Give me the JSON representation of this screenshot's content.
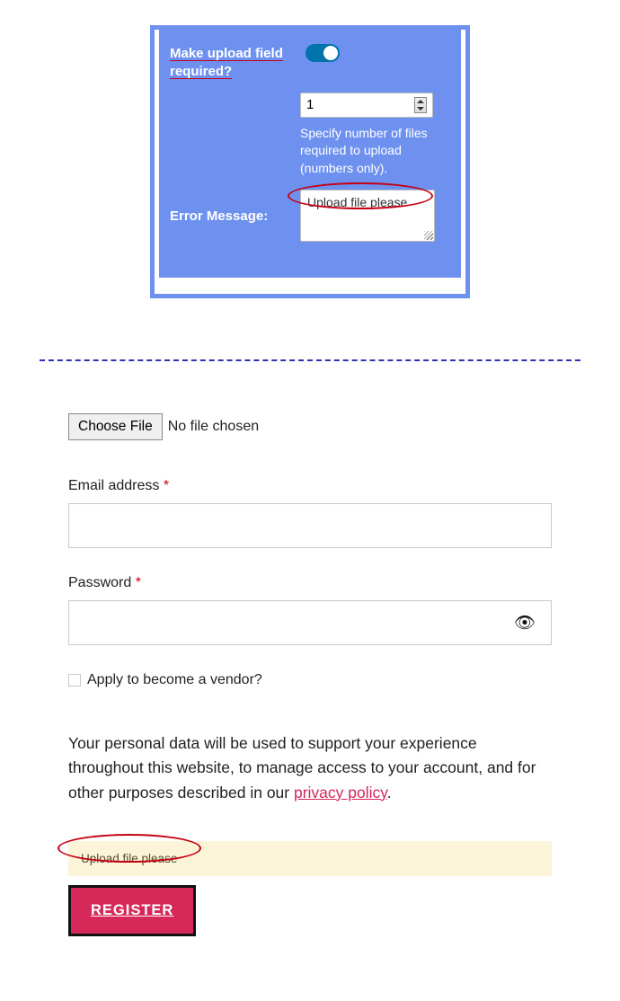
{
  "settings": {
    "make_required_label": "Make upload field required?",
    "number_value": "1",
    "number_help": "Specify number of files required to upload (numbers only).",
    "error_msg_label": "Error Message:",
    "error_msg_value": "Upload file please"
  },
  "form": {
    "choose_file_label": "Choose File",
    "no_file_text": "No file chosen",
    "email_label": "Email address",
    "password_label": "Password",
    "vendor_label": "Apply to become a vendor?",
    "privacy_text_1": "Your personal data will be used to support your experience throughout this website, to manage access to your account, and for other purposes described in our ",
    "privacy_link_text": "privacy policy",
    "privacy_text_2": ".",
    "notice_text": "Upload file please",
    "register_label": "REGISTER"
  }
}
